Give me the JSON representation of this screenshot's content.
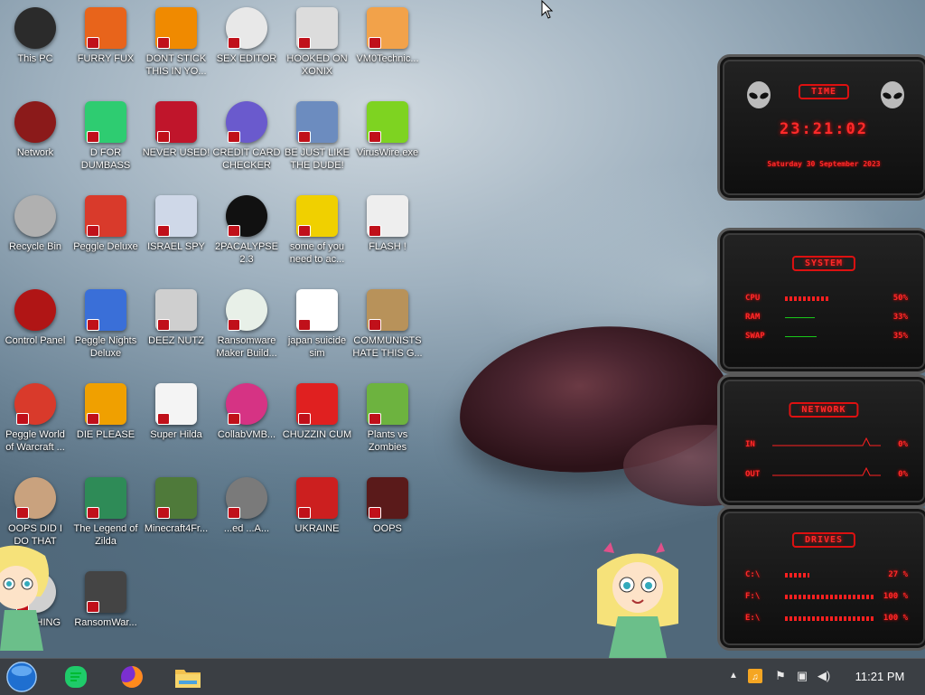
{
  "desktop": {
    "icons": [
      {
        "label": "This PC",
        "color": "#2b2b2b"
      },
      {
        "label": "FURRY FUX",
        "color": "#e8641b"
      },
      {
        "label": "DONT STICK THIS IN YO...",
        "color": "#f08a00"
      },
      {
        "label": "SEX EDITOR",
        "color": "#e8e8e8"
      },
      {
        "label": "HOOKED ON XONIX",
        "color": "#dcdcdc"
      },
      {
        "label": "VM0Technic...",
        "color": "#f2a24a"
      },
      {
        "label": "Network",
        "color": "#8b1a1a"
      },
      {
        "label": "D FOR DUMBASS",
        "color": "#2ecc71"
      },
      {
        "label": "NEVER USED!",
        "color": "#c0152b"
      },
      {
        "label": "CREDIT CARD CHECKER",
        "color": "#6a5acd"
      },
      {
        "label": "BE JUST LIKE THE DUDE!",
        "color": "#6c8cbf"
      },
      {
        "label": "VirusWire.exe",
        "color": "#7ed321"
      },
      {
        "label": "Recycle Bin",
        "color": "#b0b0b0"
      },
      {
        "label": "Peggle Deluxe",
        "color": "#d93a2b"
      },
      {
        "label": "ISRAEL SPY",
        "color": "#cfd8e8"
      },
      {
        "label": "2PACALYPSE 2.3",
        "color": "#111111"
      },
      {
        "label": "some of you need to ac...",
        "color": "#f0d000"
      },
      {
        "label": "FLASH !",
        "color": "#eeeeee"
      },
      {
        "label": "Control Panel",
        "color": "#b01515"
      },
      {
        "label": "Peggle Nights Deluxe",
        "color": "#3a6fd8"
      },
      {
        "label": "DEEZ NUTZ",
        "color": "#cfcfcf"
      },
      {
        "label": "Ransomware Maker Build...",
        "color": "#e8f0e8"
      },
      {
        "label": "japan suicide sim",
        "color": "#ffffff"
      },
      {
        "label": "COMMUNISTS HATE THIS G...",
        "color": "#b8925a"
      },
      {
        "label": "Peggle World of Warcraft ...",
        "color": "#d93a2b"
      },
      {
        "label": "DIE PLEASE",
        "color": "#f0a000"
      },
      {
        "label": "Super Hilda",
        "color": "#f4f4f4"
      },
      {
        "label": "CollabVMB...",
        "color": "#d63384"
      },
      {
        "label": "CHUZZIN CUM",
        "color": "#e02020"
      },
      {
        "label": "Plants vs Zombies",
        "color": "#6db33f"
      },
      {
        "label": "OOPS DID I DO THAT",
        "color": "#c9a27e"
      },
      {
        "label": "The Legend of Zilda",
        "color": "#2e8b57"
      },
      {
        "label": "Minecraft4Fr...",
        "color": "#4f7a3a"
      },
      {
        "label": "...ed ...A...",
        "color": "#7a7a7a"
      },
      {
        "label": "UKRAINE",
        "color": "#cc1f1f"
      },
      {
        "label": "OOPS",
        "color": "#5a1a1a"
      },
      {
        "label": "LYNCHING",
        "color": "#d0d0d0"
      },
      {
        "label": "RansomWar...",
        "color": "#444444"
      }
    ]
  },
  "gadgets": {
    "time": {
      "header": "TIME",
      "clock": "23:21:02",
      "date": "Saturday 30 September 2023"
    },
    "system": {
      "header": "SYSTEM",
      "rows": [
        {
          "key": "CPU",
          "value": "50%",
          "level": 0.5
        },
        {
          "key": "RAM",
          "value": "33%",
          "level": 0.33
        },
        {
          "key": "SWAP",
          "value": "35%",
          "level": 0.35
        }
      ]
    },
    "network": {
      "header": "NETWORK",
      "rows": [
        {
          "key": "IN",
          "value": "0%"
        },
        {
          "key": "OUT",
          "value": "0%"
        }
      ]
    },
    "drives": {
      "header": "DRIVES",
      "rows": [
        {
          "key": "C:\\",
          "value": "27 %",
          "level": 0.27
        },
        {
          "key": "F:\\",
          "value": "100 %",
          "level": 1.0
        },
        {
          "key": "E:\\",
          "value": "100 %",
          "level": 1.0
        }
      ]
    }
  },
  "taskbar": {
    "clock": "11:21 PM",
    "pinned": [
      "start-orb-icon",
      "d-app-icon",
      "firefox-icon",
      "file-explorer-icon"
    ],
    "tray": [
      "sound-app-icon",
      "flag-icon",
      "network-icon",
      "volume-icon"
    ]
  }
}
